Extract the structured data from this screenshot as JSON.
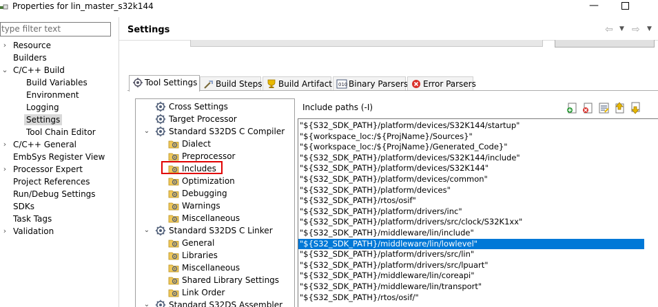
{
  "window": {
    "title": "Properties for lin_master_s32k144",
    "minimize_glyph": "—"
  },
  "left": {
    "filter_placeholder": "type filter text",
    "nav": [
      {
        "label": "Resource",
        "expand": "›"
      },
      {
        "label": "Builders"
      },
      {
        "label": "C/C++ Build",
        "expand": "⌄"
      },
      {
        "label": "Build Variables"
      },
      {
        "label": "Environment"
      },
      {
        "label": "Logging"
      },
      {
        "label": "Settings",
        "selected": true
      },
      {
        "label": "Tool Chain Editor"
      },
      {
        "label": "C/C++ General",
        "expand": "›"
      },
      {
        "label": "EmbSys Register View"
      },
      {
        "label": "Processor Expert",
        "expand": "›"
      },
      {
        "label": "Project References"
      },
      {
        "label": "Run/Debug Settings"
      },
      {
        "label": "SDKs"
      },
      {
        "label": "Task Tags"
      },
      {
        "label": "Validation",
        "expand": "›"
      }
    ]
  },
  "main": {
    "title": "Settings",
    "history": {
      "back": "⇦",
      "forward": "⇨",
      "dropdown": "▼"
    },
    "tabs": [
      {
        "label": "Tool Settings",
        "icon": "tool-settings-icon"
      },
      {
        "label": "Build Steps",
        "icon": "build-steps-icon"
      },
      {
        "label": "Build Artifact",
        "icon": "build-artifact-icon"
      },
      {
        "label": "Binary Parsers",
        "icon": "binary-parsers-icon"
      },
      {
        "label": "Error Parsers",
        "icon": "error-parsers-icon"
      }
    ],
    "tool_tree": {
      "expand_glyph": "⌄",
      "items": [
        {
          "label": "Cross Settings",
          "icon": "gear-icon"
        },
        {
          "label": "Target Processor",
          "icon": "gear-icon"
        },
        {
          "label": "Standard S32DS C Compiler",
          "icon": "gear-icon",
          "expanded": true
        },
        {
          "label": "Dialect",
          "icon": "folder-gear-icon"
        },
        {
          "label": "Preprocessor",
          "icon": "folder-gear-icon"
        },
        {
          "label": "Includes",
          "icon": "folder-gear-icon",
          "selected": true
        },
        {
          "label": "Optimization",
          "icon": "folder-gear-icon"
        },
        {
          "label": "Debugging",
          "icon": "folder-gear-icon"
        },
        {
          "label": "Warnings",
          "icon": "folder-gear-icon"
        },
        {
          "label": "Miscellaneous",
          "icon": "folder-gear-icon"
        },
        {
          "label": "Standard S32DS C Linker",
          "icon": "gear-icon",
          "expanded": true
        },
        {
          "label": "General",
          "icon": "folder-gear-icon"
        },
        {
          "label": "Libraries",
          "icon": "folder-gear-icon"
        },
        {
          "label": "Miscellaneous",
          "icon": "folder-gear-icon"
        },
        {
          "label": "Shared Library Settings",
          "icon": "folder-gear-icon"
        },
        {
          "label": "Link Order",
          "icon": "folder-gear-icon"
        },
        {
          "label": "Standard S32DS Assembler",
          "icon": "gear-icon",
          "expanded": true
        }
      ]
    },
    "include_paths": {
      "label": "Include paths (-I)",
      "toolbar": [
        "add-path-icon",
        "delete-path-icon",
        "edit-path-icon",
        "move-up-icon",
        "move-down-icon"
      ],
      "items": [
        "\"${S32_SDK_PATH}/platform/devices/S32K144/startup\"",
        "\"${workspace_loc:/${ProjName}/Sources}\"",
        "\"${workspace_loc:/${ProjName}/Generated_Code}\"",
        "\"${S32_SDK_PATH}/platform/devices/S32K144/include\"",
        "\"${S32_SDK_PATH}/platform/devices/S32K144\"",
        "\"${S32_SDK_PATH}/platform/devices/common\"",
        "\"${S32_SDK_PATH}/platform/devices\"",
        "\"${S32_SDK_PATH}/rtos/osif\"",
        "\"${S32_SDK_PATH}/platform/drivers/inc\"",
        "\"${S32_SDK_PATH}/platform/drivers/src/clock/S32K1xx\"",
        "\"${S32_SDK_PATH}/middleware/lin/include\"",
        "\"${S32_SDK_PATH}/middleware/lin/lowlevel\"",
        "\"${S32_SDK_PATH}/platform/drivers/src/lin\"",
        "\"${S32_SDK_PATH}/platform/drivers/src/lpuart\"",
        "\"${S32_SDK_PATH}/middleware/lin/coreapi\"",
        "\"${S32_SDK_PATH}/middleware/lin/transport\"",
        "\"${S32_SDK_PATH}/rtos/osif/\""
      ],
      "selected_index": 11
    }
  },
  "colors": {
    "selection": "#0078d7",
    "highlight_box": "#e00000",
    "nav_selected": "#d9d9d9"
  }
}
